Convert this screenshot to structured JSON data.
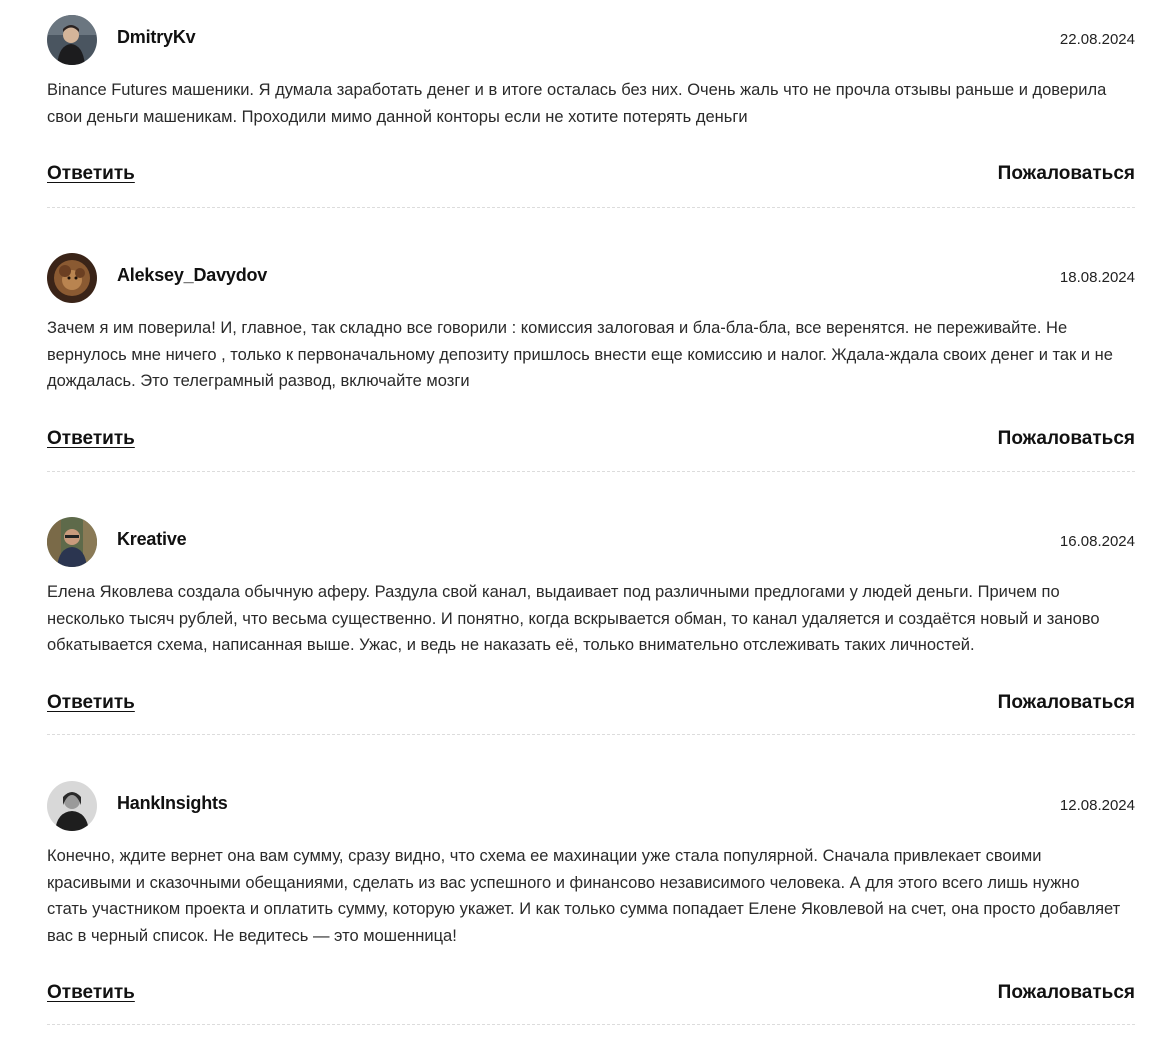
{
  "comments": [
    {
      "author": "DmitryKv",
      "date": "22.08.2024",
      "avatar": "avatar-photo-man-dark",
      "text": "Binance Futures машеники. Я думала заработать денег и в итоге осталась без них. Очень жаль что не прочла отзывы раньше и доверила свои деньги машеникам. Проходили мимо данной конторы если не хотите потерять деньги",
      "reply_label": "Ответить",
      "report_label": "Пожаловаться"
    },
    {
      "author": "Aleksey_Davydov",
      "date": "18.08.2024",
      "avatar": "avatar-photo-lion",
      "text": "Зачем я им поверила! И, главное, так складно все говорили : комиссия залоговая и бла-бла-бла, все веренятся. не переживайте. Не вернулось мне ничего , только к первоначальному депозиту пришлось внести еще комиссию и налог. Ждала-ждала своих денег и так и не дождалась. Это телеграмный развод, включайте мозги",
      "reply_label": "Ответить",
      "report_label": "Пожаловаться"
    },
    {
      "author": "Kreative",
      "date": "16.08.2024",
      "avatar": "avatar-photo-man-glasses",
      "text": "Елена Яковлева создала обычную аферу. Раздула свой канал, выдаивает под различными предлогами у людей деньги. Причем по несколько тысяч рублей, что весьма существенно. И понятно, когда вскрывается обман, то канал удаляется и создаётся новый и заново обкатывается схема, написанная выше. Ужас, и ведь не наказать её, только внимательно отслеживать таких личностей.",
      "reply_label": "Ответить",
      "report_label": "Пожаловаться"
    },
    {
      "author": "HankInsights",
      "date": "12.08.2024",
      "avatar": "avatar-photo-man-bw",
      "text": "Конечно, ждите вернет она вам сумму, сразу видно, что схема ее махинации уже стала популярной. Сначала привлекает своими красивыми и сказочными обещаниями, сделать из вас успешного и финансово независимого человека. А для этого всего лишь нужно стать участником проекта и оплатить сумму, которую укажет. И как только сумма попадает Елене Яковлевой на счет, она просто добавляет вас в черный список. Не ведитесь — это мошенница!",
      "reply_label": "Ответить",
      "report_label": "Пожаловаться"
    }
  ],
  "colors": {
    "text": "#2a2a2a",
    "heading": "#111111",
    "divider": "#dcdcdc",
    "background": "#ffffff"
  }
}
